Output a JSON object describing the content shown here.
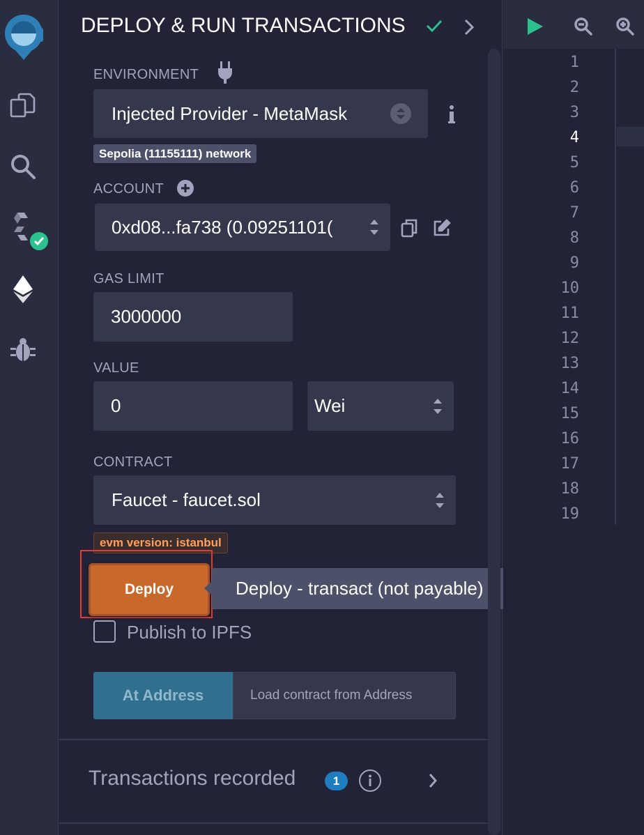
{
  "panel": {
    "title": "DEPLOY & RUN TRANSACTIONS",
    "environment": {
      "label": "ENVIRONMENT",
      "value": "Injected Provider - MetaMask",
      "network_badge": "Sepolia (11155111) network"
    },
    "account": {
      "label": "ACCOUNT",
      "value": "0xd08...fa738 (0.09251101("
    },
    "gas_limit": {
      "label": "GAS LIMIT",
      "value": "3000000"
    },
    "value": {
      "label": "VALUE",
      "amount": "0",
      "unit": "Wei"
    },
    "contract": {
      "label": "CONTRACT",
      "value": "Faucet - faucet.sol",
      "evm_badge": "evm version: istanbul"
    },
    "deploy": {
      "button_label": "Deploy",
      "tooltip": "Deploy - transact (not payable)"
    },
    "publish_ipfs": {
      "label": "Publish to IPFS",
      "checked": false
    },
    "at_address": {
      "button_label": "At Address",
      "placeholder": "Load contract from Address"
    },
    "transactions": {
      "label": "Transactions recorded",
      "count": "1"
    }
  },
  "editor": {
    "line_numbers": [
      "1",
      "2",
      "3",
      "4",
      "5",
      "6",
      "7",
      "8",
      "9",
      "10",
      "11",
      "12",
      "13",
      "14",
      "15",
      "16",
      "17",
      "18",
      "19"
    ],
    "active_line": "4"
  },
  "colors": {
    "accent_deploy": "#c8682a",
    "success_green": "#2cc28d",
    "at_address": "#316f8f",
    "badge_blue": "#1e7ec0"
  }
}
